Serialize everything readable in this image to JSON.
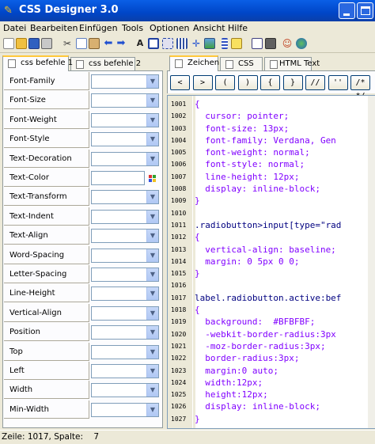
{
  "window": {
    "title": "CSS Designer 3.0"
  },
  "menu": [
    "Datei",
    "Bearbeiten",
    "Einfügen",
    "Tools",
    "Optionen",
    "Ansicht",
    "Hilfe"
  ],
  "toolbar": [
    "new-icon",
    "open-icon",
    "save-icon",
    "print-icon",
    "cut-icon",
    "copy-icon",
    "paste-icon",
    "undo-icon",
    "redo-icon",
    "font-icon",
    "box-icon",
    "border-icon",
    "table-icon",
    "move-icon",
    "image-icon",
    "list-icon",
    "pen-icon",
    "check-icon",
    "note-icon",
    "user-icon",
    "globe-icon"
  ],
  "left_tabs": [
    {
      "label": "css befehle 1"
    },
    {
      "label": "css befehle 2"
    }
  ],
  "properties": [
    "Font-Family",
    "Font-Size",
    "Font-Weight",
    "Font-Style",
    "Text-Decoration",
    "Text-Color",
    "Text-Transform",
    "Text-Indent",
    "Text-Align",
    "Word-Spacing",
    "Letter-Spacing",
    "Line-Height",
    "Vertical-Align",
    "Position",
    "Top",
    "Left",
    "Width",
    "Min-Width"
  ],
  "right_tabs": [
    {
      "label": "Zeichen"
    },
    {
      "label": "CSS"
    },
    {
      "label": "HTML Text"
    }
  ],
  "symbols": [
    "<",
    ">",
    "(",
    ")",
    "{",
    "}",
    "//",
    "''",
    "/* */"
  ],
  "editor": {
    "lines": [
      {
        "n": "1001",
        "t": "{",
        "c": "#8000ff"
      },
      {
        "n": "1002",
        "t": "  cursor: pointer;",
        "c": "#8000ff"
      },
      {
        "n": "1003",
        "t": "  font-size: 13px;",
        "c": "#8000ff"
      },
      {
        "n": "1004",
        "t": "  font-family: Verdana, Gen",
        "c": "#8000ff"
      },
      {
        "n": "1005",
        "t": "  font-weight: normal;",
        "c": "#8000ff"
      },
      {
        "n": "1006",
        "t": "  font-style: normal;",
        "c": "#8000ff"
      },
      {
        "n": "1007",
        "t": "  line-height: 12px;",
        "c": "#8000ff"
      },
      {
        "n": "1008",
        "t": "  display: inline-block;",
        "c": "#8000ff"
      },
      {
        "n": "1009",
        "t": "}",
        "c": "#8000ff"
      },
      {
        "n": "1010",
        "t": "",
        "c": "#000"
      },
      {
        "n": "1011",
        "t": ".radiobutton>input[type=\"rad",
        "c": "#000080"
      },
      {
        "n": "1012",
        "t": "{",
        "c": "#8000ff"
      },
      {
        "n": "1013",
        "t": "  vertical-align: baseline;",
        "c": "#8000ff"
      },
      {
        "n": "1014",
        "t": "  margin: 0 5px 0 0;",
        "c": "#8000ff"
      },
      {
        "n": "1015",
        "t": "}",
        "c": "#8000ff"
      },
      {
        "n": "1016",
        "t": "",
        "c": "#000"
      },
      {
        "n": "1017",
        "t": "label.radiobutton.active:bef",
        "c": "#000080"
      },
      {
        "n": "1018",
        "t": "{",
        "c": "#8000ff"
      },
      {
        "n": "1019",
        "t": "  background:  #BFBFBF;",
        "c": "#8000ff"
      },
      {
        "n": "1020",
        "t": "  -webkit-border-radius:3px",
        "c": "#8000ff"
      },
      {
        "n": "1021",
        "t": "  -moz-border-radius:3px;",
        "c": "#8000ff"
      },
      {
        "n": "1022",
        "t": "  border-radius:3px;",
        "c": "#8000ff"
      },
      {
        "n": "1023",
        "t": "  margin:0 auto;",
        "c": "#8000ff"
      },
      {
        "n": "1024",
        "t": "  width:12px;",
        "c": "#8000ff"
      },
      {
        "n": "1025",
        "t": "  height:12px;",
        "c": "#8000ff"
      },
      {
        "n": "1026",
        "t": "  display: inline-block;",
        "c": "#8000ff"
      },
      {
        "n": "1027",
        "t": "}",
        "c": "#8000ff"
      }
    ]
  },
  "status": {
    "text": "Zeile: 1017, Spalte:    7"
  }
}
